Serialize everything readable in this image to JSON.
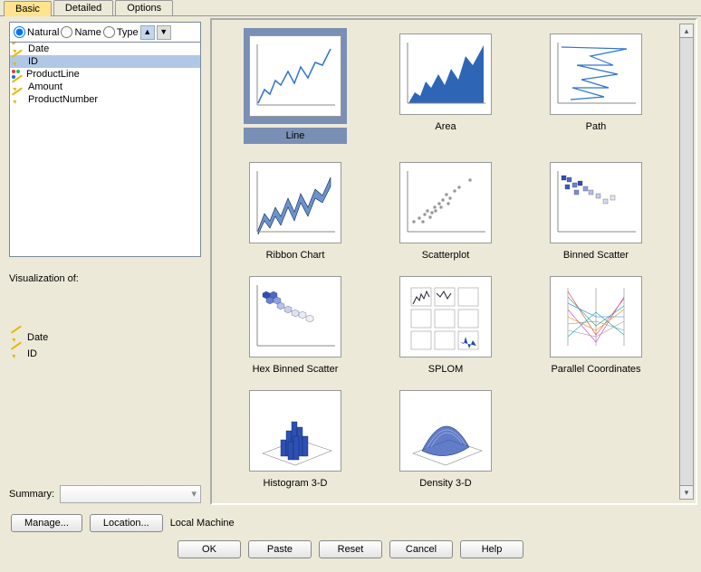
{
  "tabs": {
    "t0": "Basic",
    "t1": "Detailed",
    "t2": "Options",
    "active": 0
  },
  "sort": {
    "r0": "Natural",
    "r1": "Name",
    "r2": "Type",
    "asc": "▲",
    "desc": "▼"
  },
  "fields": {
    "f0": "Date",
    "f1": "ID",
    "f2": "ProductLine",
    "f3": "Amount",
    "f4": "ProductNumber"
  },
  "viz_of": {
    "title": "Visualization of:",
    "i0": "Date",
    "i1": "ID"
  },
  "summary": {
    "label": "Summary:"
  },
  "charts": {
    "c0": "Line",
    "c1": "Area",
    "c2": "Path",
    "c3": "Ribbon Chart",
    "c4": "Scatterplot",
    "c5": "Binned Scatter",
    "c6": "Hex Binned Scatter",
    "c7": "SPLOM",
    "c8": "Parallel Coordinates",
    "c9": "Histogram 3-D",
    "c10": "Density 3-D"
  },
  "bottom": {
    "manage": "Manage...",
    "location": "Location...",
    "local": "Local Machine"
  },
  "actions": {
    "ok": "OK",
    "paste": "Paste",
    "reset": "Reset",
    "cancel": "Cancel",
    "help": "Help"
  }
}
